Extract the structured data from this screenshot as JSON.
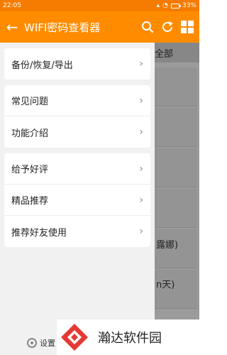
{
  "status_bar": {
    "time": "22:05",
    "battery": "33%"
  },
  "app_bar": {
    "back_icon": "arrow-left-icon",
    "title": "WIFI密码查看器",
    "actions": [
      "search-icon",
      "refresh-icon",
      "grid-icon"
    ]
  },
  "background": {
    "tab_label": "全部",
    "fragments": [
      "露娜)",
      "n天)"
    ]
  },
  "drawer": {
    "groups": [
      {
        "items": [
          {
            "label": "备份/恢复/导出"
          }
        ]
      },
      {
        "items": [
          {
            "label": "常见问题"
          },
          {
            "label": "功能介绍"
          }
        ]
      },
      {
        "items": [
          {
            "label": "给予好评"
          },
          {
            "label": "精品推荐"
          },
          {
            "label": "推荐好友使用"
          }
        ]
      }
    ],
    "settings_label": "设置"
  },
  "watermark": {
    "text": "瀚达软件园"
  },
  "colors": {
    "primary": "#ff8c00",
    "status": "#f57c00",
    "drawer_bg": "#f1f1f1"
  }
}
